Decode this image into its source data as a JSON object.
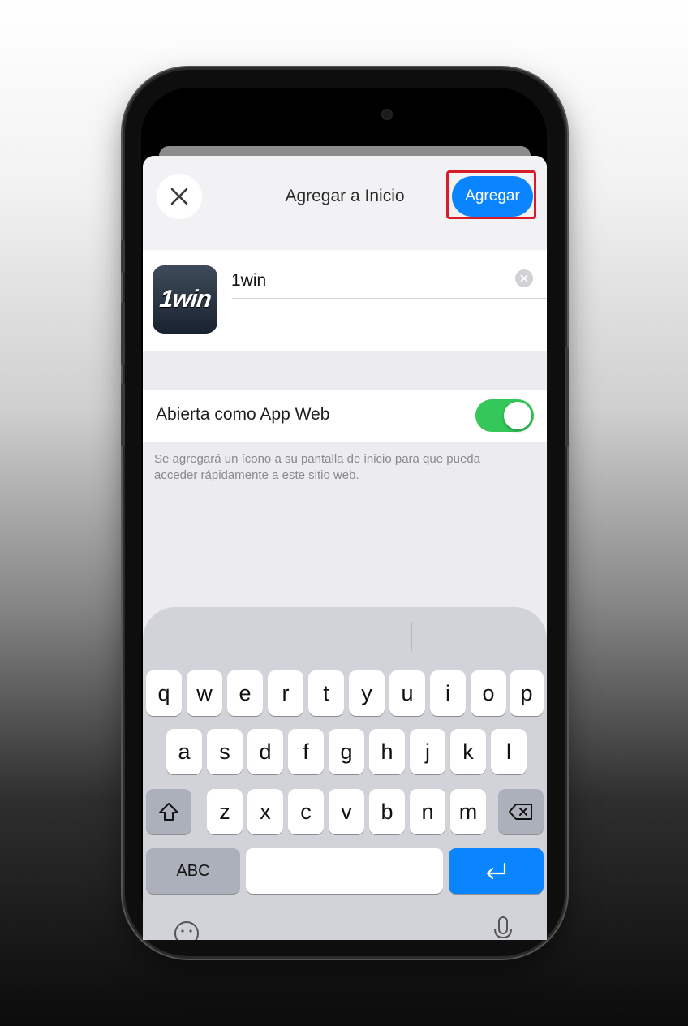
{
  "sheet": {
    "title": "Agregar a Inicio",
    "add_label": "Agregar",
    "close_icon": "close-icon"
  },
  "name_field": {
    "value": "1win",
    "app_icon_text": "1win"
  },
  "webapp": {
    "label": "Abierta como App Web",
    "enabled": true
  },
  "footnote": "Se agregará un ícono a su pantalla de inicio para que pueda acceder rápidamente a este sitio web.",
  "keyboard": {
    "row1": [
      "q",
      "w",
      "e",
      "r",
      "t",
      "y",
      "u",
      "i",
      "o",
      "p"
    ],
    "row2": [
      "a",
      "s",
      "d",
      "f",
      "g",
      "h",
      "j",
      "k",
      "l"
    ],
    "row3": [
      "z",
      "x",
      "c",
      "v",
      "b",
      "n",
      "m"
    ],
    "abc_label": "ABC",
    "icons": [
      "shift-icon",
      "delete-icon",
      "return-icon",
      "emoji-icon",
      "microphone-icon"
    ]
  },
  "colors": {
    "accent": "#0a84ff",
    "toggle_on": "#34c759",
    "highlight": "#d71b2a"
  }
}
